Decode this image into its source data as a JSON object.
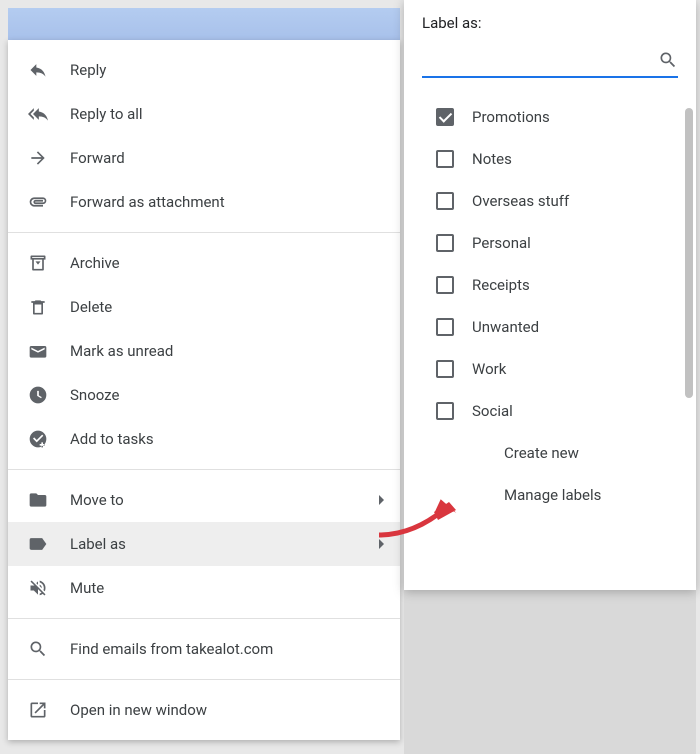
{
  "context_menu": {
    "reply": "Reply",
    "reply_all": "Reply to all",
    "forward": "Forward",
    "forward_attachment": "Forward as attachment",
    "archive": "Archive",
    "delete": "Delete",
    "mark_unread": "Mark as unread",
    "snooze": "Snooze",
    "add_tasks": "Add to tasks",
    "move_to": "Move to",
    "label_as": "Label as",
    "mute": "Mute",
    "find_emails": "Find emails from takealot.com",
    "open_new_window": "Open in new window"
  },
  "popover": {
    "title": "Label as:",
    "search_placeholder": "",
    "labels": [
      {
        "name": "Promotions",
        "checked": true
      },
      {
        "name": "Notes",
        "checked": false
      },
      {
        "name": "Overseas stuff",
        "checked": false
      },
      {
        "name": "Personal",
        "checked": false
      },
      {
        "name": "Receipts",
        "checked": false
      },
      {
        "name": "Unwanted",
        "checked": false
      },
      {
        "name": "Work",
        "checked": false
      },
      {
        "name": "Social",
        "checked": false
      }
    ],
    "create_new": "Create new",
    "manage_labels": "Manage labels"
  }
}
